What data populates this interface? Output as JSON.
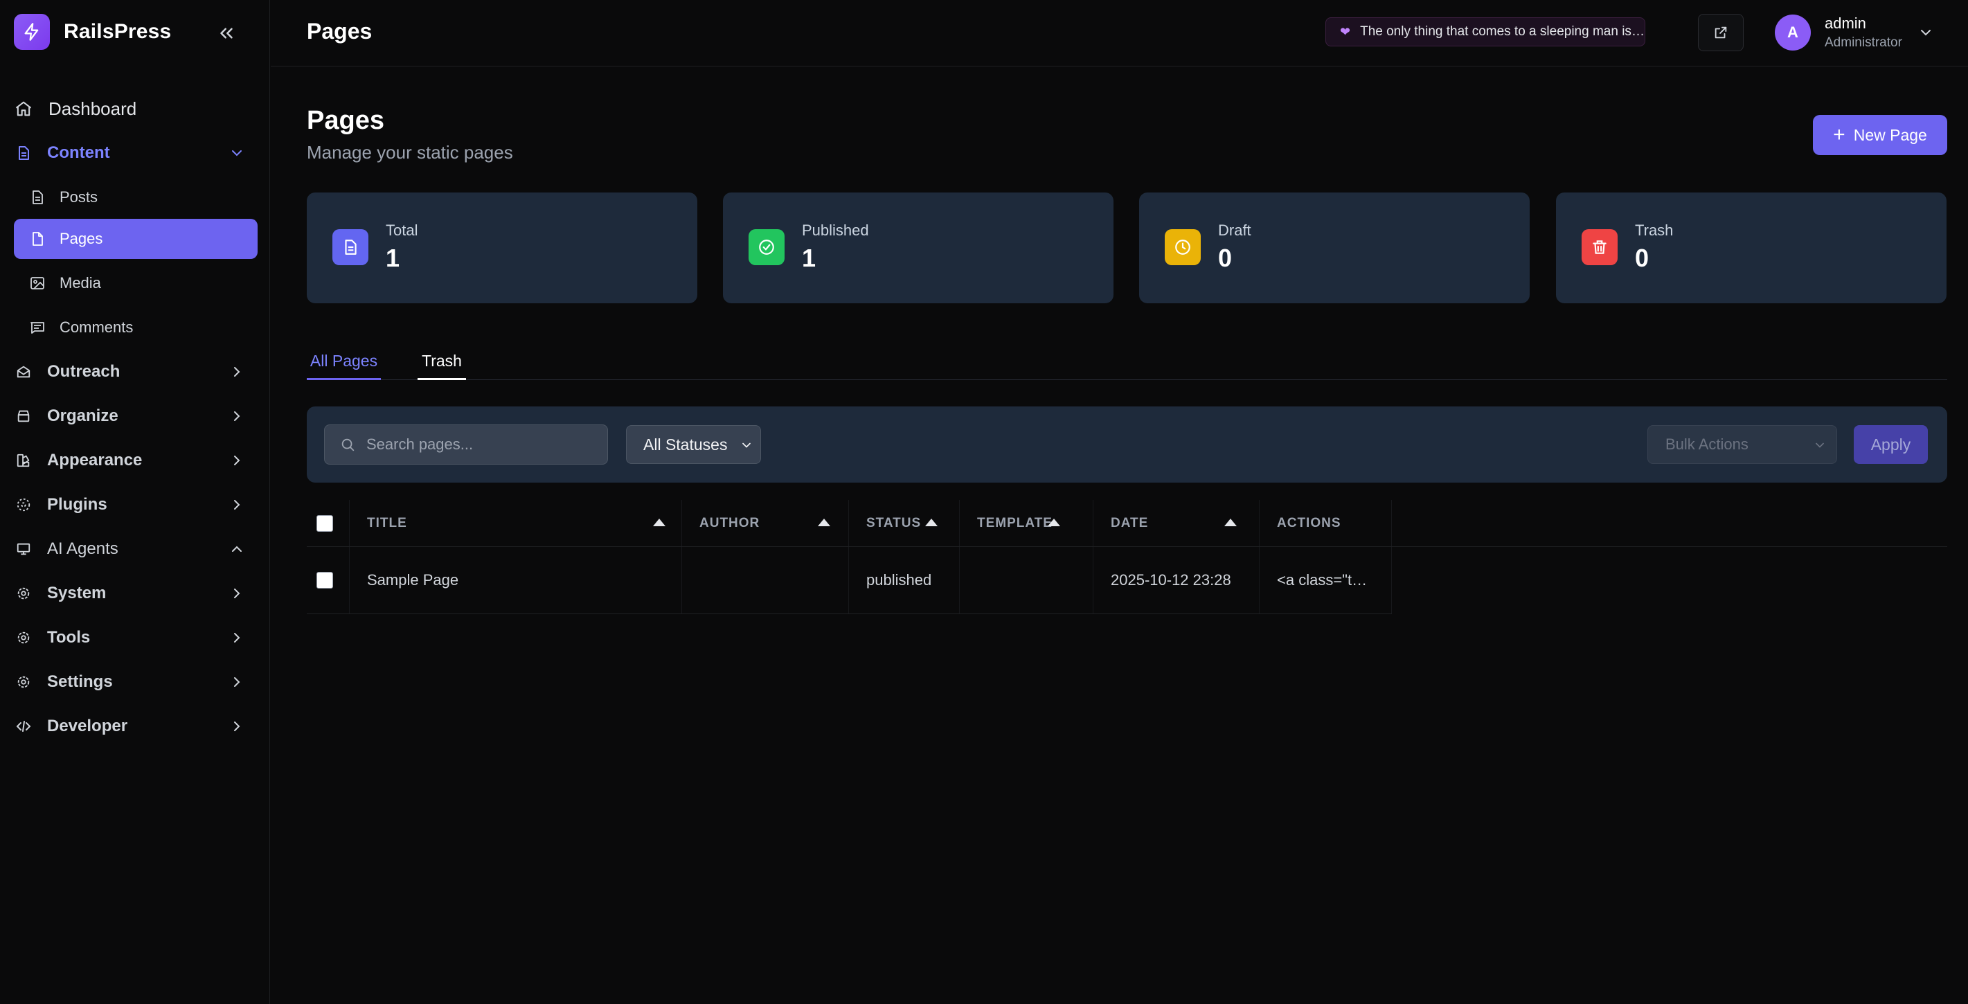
{
  "brand": {
    "name": "RailsPress"
  },
  "sidebar": {
    "dashboard": "Dashboard",
    "content": "Content",
    "content_items": [
      "Posts",
      "Pages",
      "Media",
      "Comments"
    ],
    "sections": [
      "Outreach",
      "Organize",
      "Appearance",
      "Plugins",
      "AI Agents",
      "System",
      "Tools",
      "Settings",
      "Developer"
    ]
  },
  "header": {
    "title": "Pages",
    "quote": "The only thing that comes to a sleeping man is dreams.",
    "user": {
      "initial": "A",
      "name": "admin",
      "role": "Administrator"
    }
  },
  "page": {
    "title": "Pages",
    "subtitle": "Manage your static pages",
    "new_button": "New Page"
  },
  "stats": [
    {
      "label": "Total",
      "value": "1",
      "color": "#6366f1",
      "icon": "document-icon"
    },
    {
      "label": "Published",
      "value": "1",
      "color": "#22c55e",
      "icon": "check-circle-icon"
    },
    {
      "label": "Draft",
      "value": "0",
      "color": "#eab308",
      "icon": "clock-icon"
    },
    {
      "label": "Trash",
      "value": "0",
      "color": "#ef4444",
      "icon": "trash-icon"
    }
  ],
  "tabs": [
    "All Pages",
    "Trash"
  ],
  "filters": {
    "search_placeholder": "Search pages...",
    "status_selected": "All Statuses",
    "bulk_placeholder": "Bulk Actions",
    "apply_label": "Apply"
  },
  "table": {
    "columns": [
      "TITLE",
      "AUTHOR",
      "STATUS",
      "TEMPLATE",
      "DATE",
      "ACTIONS"
    ],
    "rows": [
      {
        "title": "Sample Page",
        "author": "",
        "status": "published",
        "template": "",
        "date": "2025-10-12 23:28",
        "actions": "<a class=\"t…"
      }
    ]
  },
  "colors": {
    "accent": "#6d64f0",
    "panel": "#1e2a3b",
    "background": "#0a0a0b"
  }
}
